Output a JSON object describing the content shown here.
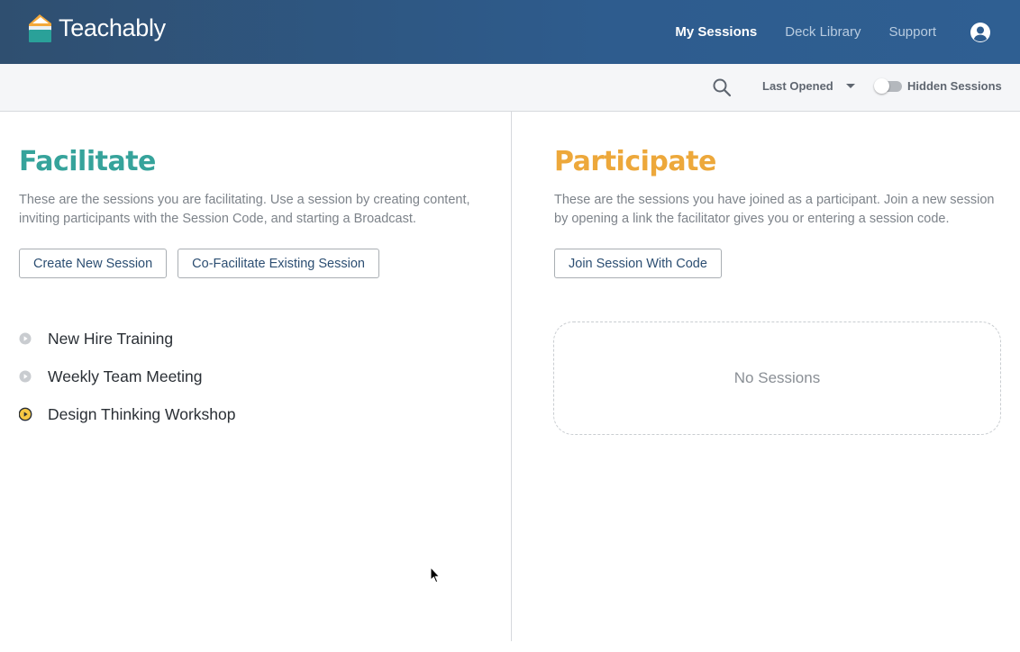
{
  "app": {
    "name": "Teachably"
  },
  "nav": {
    "items": [
      {
        "label": "My Sessions",
        "active": true
      },
      {
        "label": "Deck Library",
        "active": false
      },
      {
        "label": "Support",
        "active": false
      }
    ],
    "account_icon": "user-circle-icon"
  },
  "toolbar": {
    "search_icon": "search-icon",
    "sort_selected": "Last Opened",
    "hidden_toggle_label": "Hidden Sessions",
    "hidden_toggle_on": false
  },
  "facilitate": {
    "title": "Facilitate",
    "description": "These are the sessions you are facilitating. Use a session by creating content, inviting participants with the Session Code, and starting a Broadcast.",
    "buttons": {
      "create": "Create New Session",
      "cofacilitate": "Co-Facilitate Existing Session"
    },
    "sessions": [
      {
        "name": "New Hire Training",
        "live": false
      },
      {
        "name": "Weekly Team Meeting",
        "live": false
      },
      {
        "name": "Design Thinking Workshop",
        "live": true
      }
    ]
  },
  "participate": {
    "title": "Participate",
    "description": "These are the sessions you have joined as a participant. Join a new session by opening a link the facilitator gives you or entering a session code.",
    "buttons": {
      "join": "Join Session With Code"
    },
    "empty_text": "No Sessions"
  },
  "colors": {
    "header": "#2e5c8e",
    "facilitate_accent": "#36a39b",
    "participate_accent": "#eda83b",
    "live_indicator": "#f6c843"
  }
}
